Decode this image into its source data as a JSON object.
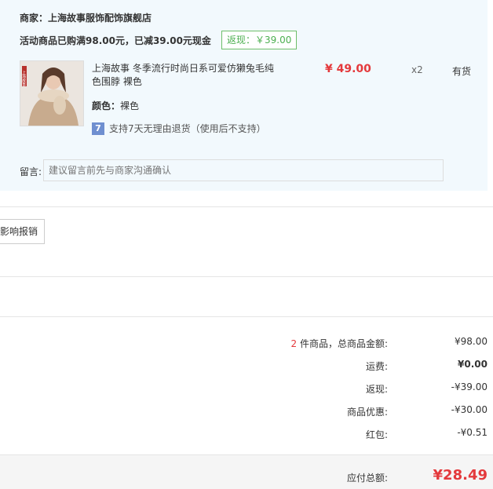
{
  "shop": {
    "merchant": "商家：上海故事服饰配饰旗舰店",
    "promo": "活动商品已购满98.00元，已减39.00元现金",
    "cashback_badge": "返现：￥39.00"
  },
  "product": {
    "title": "上海故事 冬季流行时尚日系可爱仿獭兔毛纯色围脖 裸色",
    "color_label": "颜色：",
    "color_value": "裸色",
    "price": "¥ 49.00",
    "quantity": "x2",
    "stock": "有货",
    "return_badge_text": "7",
    "return_policy": "支持7天无理由退货（使用后不支持）",
    "thumb_logo_text": "上海故事"
  },
  "message": {
    "label": "留言:",
    "placeholder": "建议留言前先与商家沟通确认"
  },
  "invoice_button": "影响报销",
  "summary": {
    "count": "2",
    "items_label": " 件商品，总商品金额:",
    "items_value": "¥98.00",
    "shipping_label": "运费:",
    "shipping_value": "¥0.00",
    "cashback_label": "返现:",
    "cashback_value": "-¥39.00",
    "discount_label": "商品优惠:",
    "discount_value": "-¥30.00",
    "redpacket_label": "红包:",
    "redpacket_value": "-¥0.51",
    "total_label": "应付总额:",
    "total_value": "¥28.49"
  },
  "colors": {
    "accent_red": "#e4393c",
    "cashback_green": "#4caf50",
    "shop_bg": "#f2f9fd"
  }
}
